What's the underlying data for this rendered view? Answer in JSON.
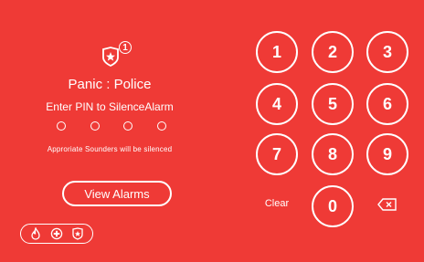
{
  "status": {
    "alarm_count": "1",
    "title": "Panic : Police",
    "prompt": "Enter PIN to SilenceAlarm",
    "note": "Approriate Sounders will be silenced"
  },
  "pin": {
    "length": 4,
    "entered": 0
  },
  "buttons": {
    "view_alarms": "View Alarms",
    "clear": "Clear"
  },
  "keypad": [
    "1",
    "2",
    "3",
    "4",
    "5",
    "6",
    "7",
    "8",
    "9",
    "0"
  ],
  "alarm_types": [
    "fire-icon",
    "medical-icon",
    "police-badge-icon"
  ],
  "colors": {
    "background": "#ef3a36",
    "foreground": "#ffffff"
  }
}
